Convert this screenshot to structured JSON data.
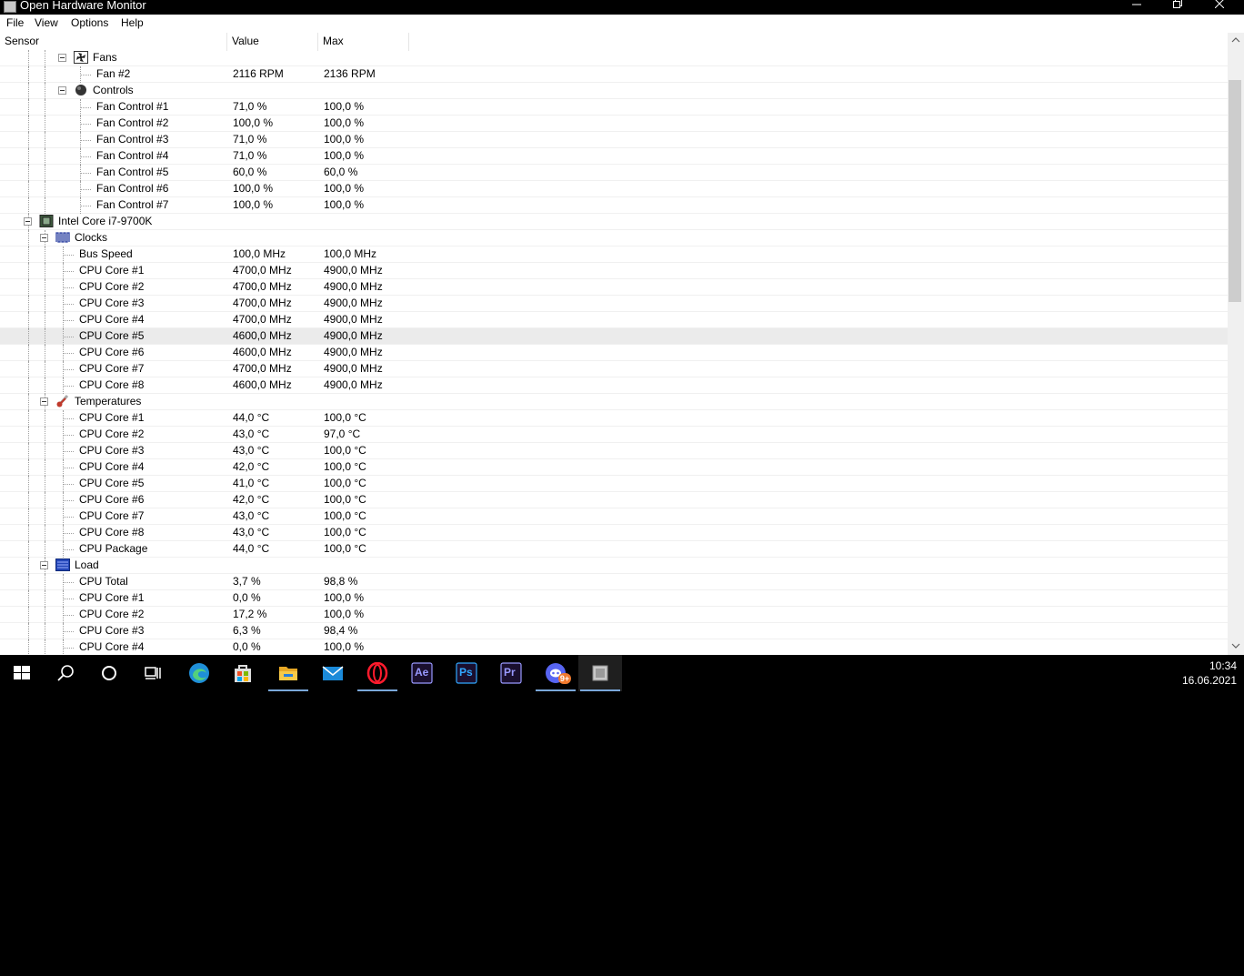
{
  "window": {
    "title": "Open Hardware Monitor"
  },
  "menu": [
    "File",
    "View",
    "Options",
    "Help"
  ],
  "columns": {
    "sensor": "Sensor",
    "value": "Value",
    "max": "Max"
  },
  "rows": [
    {
      "name": "Fans",
      "value": "",
      "max": "",
      "level": 2,
      "type": "group",
      "icon": "fan-icon"
    },
    {
      "name": "Fan #2",
      "value": "2116 RPM",
      "max": "2136 RPM",
      "level": 3
    },
    {
      "name": "Controls",
      "value": "",
      "max": "",
      "level": 2,
      "type": "group",
      "icon": "control-knob-icon"
    },
    {
      "name": "Fan Control #1",
      "value": "71,0 %",
      "max": "100,0 %",
      "level": 3
    },
    {
      "name": "Fan Control #2",
      "value": "100,0 %",
      "max": "100,0 %",
      "level": 3
    },
    {
      "name": "Fan Control #3",
      "value": "71,0 %",
      "max": "100,0 %",
      "level": 3
    },
    {
      "name": "Fan Control #4",
      "value": "71,0 %",
      "max": "100,0 %",
      "level": 3
    },
    {
      "name": "Fan Control #5",
      "value": "60,0 %",
      "max": "60,0 %",
      "level": 3
    },
    {
      "name": "Fan Control #6",
      "value": "100,0 %",
      "max": "100,0 %",
      "level": 3
    },
    {
      "name": "Fan Control #7",
      "value": "100,0 %",
      "max": "100,0 %",
      "level": 3
    },
    {
      "name": "Intel Core i7-9700K",
      "value": "",
      "max": "",
      "level": 1,
      "type": "group",
      "icon": "cpu-chip-icon"
    },
    {
      "name": "Clocks",
      "value": "",
      "max": "",
      "level": 2,
      "type": "group",
      "icon": "clock-wave-icon"
    },
    {
      "name": "Bus Speed",
      "value": "100,0 MHz",
      "max": "100,0 MHz",
      "level": 3
    },
    {
      "name": "CPU Core #1",
      "value": "4700,0 MHz",
      "max": "4900,0 MHz",
      "level": 3
    },
    {
      "name": "CPU Core #2",
      "value": "4700,0 MHz",
      "max": "4900,0 MHz",
      "level": 3
    },
    {
      "name": "CPU Core #3",
      "value": "4700,0 MHz",
      "max": "4900,0 MHz",
      "level": 3
    },
    {
      "name": "CPU Core #4",
      "value": "4700,0 MHz",
      "max": "4900,0 MHz",
      "level": 3
    },
    {
      "name": "CPU Core #5",
      "value": "4600,0 MHz",
      "max": "4900,0 MHz",
      "level": 3,
      "selected": true
    },
    {
      "name": "CPU Core #6",
      "value": "4600,0 MHz",
      "max": "4900,0 MHz",
      "level": 3
    },
    {
      "name": "CPU Core #7",
      "value": "4700,0 MHz",
      "max": "4900,0 MHz",
      "level": 3
    },
    {
      "name": "CPU Core #8",
      "value": "4600,0 MHz",
      "max": "4900,0 MHz",
      "level": 3
    },
    {
      "name": "Temperatures",
      "value": "",
      "max": "",
      "level": 2,
      "type": "group",
      "icon": "thermometer-icon"
    },
    {
      "name": "CPU Core #1",
      "value": "44,0 °C",
      "max": "100,0 °C",
      "level": 3
    },
    {
      "name": "CPU Core #2",
      "value": "43,0 °C",
      "max": "97,0 °C",
      "level": 3
    },
    {
      "name": "CPU Core #3",
      "value": "43,0 °C",
      "max": "100,0 °C",
      "level": 3
    },
    {
      "name": "CPU Core #4",
      "value": "42,0 °C",
      "max": "100,0 °C",
      "level": 3
    },
    {
      "name": "CPU Core #5",
      "value": "41,0 °C",
      "max": "100,0 °C",
      "level": 3
    },
    {
      "name": "CPU Core #6",
      "value": "42,0 °C",
      "max": "100,0 °C",
      "level": 3
    },
    {
      "name": "CPU Core #7",
      "value": "43,0 °C",
      "max": "100,0 °C",
      "level": 3
    },
    {
      "name": "CPU Core #8",
      "value": "43,0 °C",
      "max": "100,0 °C",
      "level": 3
    },
    {
      "name": "CPU Package",
      "value": "44,0 °C",
      "max": "100,0 °C",
      "level": 3
    },
    {
      "name": "Load",
      "value": "",
      "max": "",
      "level": 2,
      "type": "group",
      "icon": "load-bars-icon"
    },
    {
      "name": "CPU Total",
      "value": "3,7 %",
      "max": "98,8 %",
      "level": 3
    },
    {
      "name": "CPU Core #1",
      "value": "0,0 %",
      "max": "100,0 %",
      "level": 3
    },
    {
      "name": "CPU Core #2",
      "value": "17,2 %",
      "max": "100,0 %",
      "level": 3
    },
    {
      "name": "CPU Core #3",
      "value": "6,3 %",
      "max": "98,4 %",
      "level": 3
    },
    {
      "name": "CPU Core #4",
      "value": "0,0 %",
      "max": "100,0 %",
      "level": 3
    }
  ],
  "taskbar": {
    "items": [
      {
        "name": "start-button",
        "icon": "windows-logo-icon"
      },
      {
        "name": "search-button",
        "icon": "search-icon"
      },
      {
        "name": "cortana-button",
        "icon": "cortana-circle-icon"
      },
      {
        "name": "task-view-button",
        "icon": "task-view-icon"
      },
      {
        "name": "edge-button",
        "icon": "edge-icon"
      },
      {
        "name": "store-button",
        "icon": "store-bag-icon"
      },
      {
        "name": "file-explorer-button",
        "icon": "folder-icon",
        "running": true
      },
      {
        "name": "mail-button",
        "icon": "mail-envelope-icon"
      },
      {
        "name": "opera-button",
        "icon": "opera-icon",
        "running": true
      },
      {
        "name": "after-effects-button",
        "icon": "after-effects-icon",
        "label": "Ae"
      },
      {
        "name": "photoshop-button",
        "icon": "photoshop-icon",
        "label": "Ps"
      },
      {
        "name": "premiere-button",
        "icon": "premiere-icon",
        "label": "Pr"
      },
      {
        "name": "discord-button",
        "icon": "discord-icon",
        "badge": "9+",
        "running": true
      },
      {
        "name": "open-hardware-monitor-button",
        "icon": "hardware-monitor-icon",
        "running": true,
        "active": true
      }
    ],
    "clock": {
      "time": "10:34",
      "date": "16.06.2021"
    }
  },
  "colors": {
    "taskbar": "#000000",
    "titlebar": "#000000",
    "selection": "#ebebeb",
    "running_indicator": "#7aa7d9",
    "adobe_ae": "#9999ff",
    "adobe_ps": "#31a8ff",
    "adobe_pr": "#9999ff",
    "discord": "#5865f2",
    "opera": "#ff1b2d"
  }
}
